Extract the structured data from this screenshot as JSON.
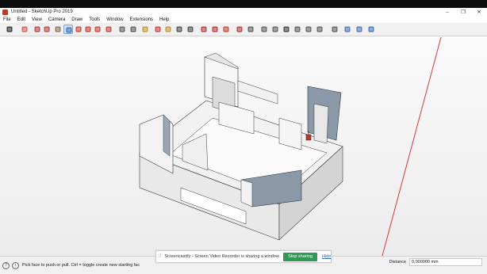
{
  "window": {
    "title": "Untitled - SketchUp Pro 2019",
    "controls": [
      "–",
      "❐",
      "✕"
    ]
  },
  "menu": [
    "File",
    "Edit",
    "View",
    "Camera",
    "Draw",
    "Tools",
    "Window",
    "Extensions",
    "Help"
  ],
  "toolbar": {
    "tools": [
      {
        "name": "select-tool",
        "color": "#222222"
      },
      {
        "name": "eraser-tool",
        "color": "#c85b5b"
      },
      {
        "name": "line-tool",
        "color": "#b23c3c"
      },
      {
        "name": "arc-tool",
        "color": "#b23c3c"
      },
      {
        "name": "rectangle-tool",
        "color": "#8a6a4a"
      },
      {
        "name": "push-pull-tool",
        "color": "#2f67b0"
      },
      {
        "name": "offset-tool",
        "color": "#c0392b"
      },
      {
        "name": "move-tool",
        "color": "#c0392b"
      },
      {
        "name": "rotate-tool",
        "color": "#c0392b"
      },
      {
        "name": "scale-tool",
        "color": "#c0392b"
      },
      {
        "name": "tape-measure-tool",
        "color": "#555555"
      },
      {
        "name": "text-tool",
        "color": "#555555"
      },
      {
        "name": "paint-bucket-tool",
        "color": "#c28f2c"
      },
      {
        "name": "orbit-tool",
        "color": "#c0392b"
      },
      {
        "name": "pan-tool",
        "color": "#c28f2c"
      },
      {
        "name": "zoom-tool",
        "color": "#444444"
      },
      {
        "name": "zoom-extents-tool",
        "color": "#444444"
      },
      {
        "name": "warehouse-tool",
        "color": "#b03030"
      },
      {
        "name": "extension-warehouse-tool",
        "color": "#b03030"
      },
      {
        "name": "layout-tool",
        "color": "#c0392b"
      },
      {
        "name": "extension-manager-tool",
        "color": "#b03030"
      },
      {
        "name": "style-tool",
        "color": "#555555"
      },
      {
        "name": "iso-view-tool",
        "color": "#555555"
      },
      {
        "name": "top-view-tool",
        "color": "#555555"
      },
      {
        "name": "front-view-tool",
        "color": "#333333"
      },
      {
        "name": "right-view-tool",
        "color": "#555555"
      },
      {
        "name": "back-view-tool",
        "color": "#555555"
      },
      {
        "name": "left-view-tool",
        "color": "#555555"
      },
      {
        "name": "section-plane-tool",
        "color": "#555555"
      },
      {
        "name": "section-display-tool",
        "color": "#3b6fb5"
      },
      {
        "name": "section-cut-tool",
        "color": "#3b6fb5"
      },
      {
        "name": "section-fill-tool",
        "color": "#3b6fb5"
      }
    ]
  },
  "status": {
    "hint": "Pick face to push or pull.  Ctrl = toggle create new starting fac",
    "measure_label": "Distance",
    "measure_value": "0,000000 mm"
  },
  "sharing": {
    "grip": "⁞⁞",
    "message": "Screencastify - Screen Video Recorder is sharing a window.",
    "stop_label": "Stop sharing",
    "hide_label": "Hide"
  },
  "colors": {
    "model_face": "#f4f4f4",
    "model_side": "#d6d6d6",
    "selected_face": "#8a98a8",
    "red_axis": "#d23b3b",
    "green_axis": "#3a9a3a"
  }
}
